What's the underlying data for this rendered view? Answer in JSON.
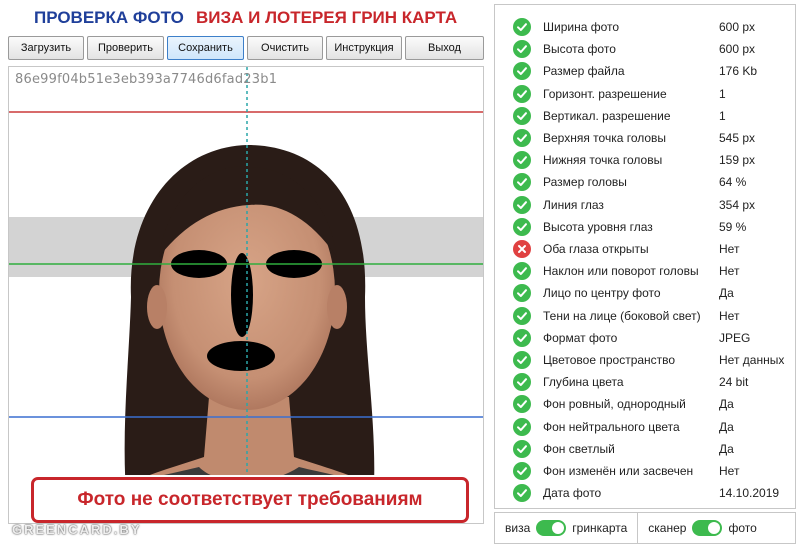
{
  "header": {
    "title_check": "ПРОВЕРКА ФОТО",
    "title_visa": "ВИЗА И ЛОТЕРЕЯ ГРИН КАРТА"
  },
  "toolbar": {
    "buttons": [
      {
        "label": "Загрузить"
      },
      {
        "label": "Проверить"
      },
      {
        "label": "Сохранить"
      },
      {
        "label": "Очистить"
      },
      {
        "label": "Инструкция"
      },
      {
        "label": "Выход"
      }
    ],
    "active": "Сохранить"
  },
  "photo": {
    "hash": "86e99f04b51e3eb393a7746d6fad23b1",
    "warning": "Фото не соответствует требованиям",
    "watermark": "GREENCARD.BY"
  },
  "checks": [
    {
      "label": "Ширина фото",
      "value": "600 px",
      "status": "ok"
    },
    {
      "label": "Высота фото",
      "value": "600 px",
      "status": "ok"
    },
    {
      "label": "Размер файла",
      "value": "176 Kb",
      "status": "ok"
    },
    {
      "label": "Горизонт. разрешение",
      "value": "1",
      "status": "ok"
    },
    {
      "label": "Вертикал. разрешение",
      "value": "1",
      "status": "ok"
    },
    {
      "label": "Верхняя точка головы",
      "value": "545 px",
      "status": "ok"
    },
    {
      "label": "Нижняя точка головы",
      "value": "159 px",
      "status": "ok"
    },
    {
      "label": "Размер головы",
      "value": "64 %",
      "status": "ok"
    },
    {
      "label": "Линия глаз",
      "value": "354 px",
      "status": "ok"
    },
    {
      "label": "Высота уровня глаз",
      "value": "59 %",
      "status": "ok"
    },
    {
      "label": "Оба глаза открыты",
      "value": "Нет",
      "status": "fail"
    },
    {
      "label": "Наклон или поворот головы",
      "value": "Нет",
      "status": "ok"
    },
    {
      "label": "Лицо по центру фото",
      "value": "Да",
      "status": "ok"
    },
    {
      "label": "Тени на лице (боковой свет)",
      "value": "Нет",
      "status": "ok"
    },
    {
      "label": "Формат фото",
      "value": "JPEG",
      "status": "ok"
    },
    {
      "label": "Цветовое пространство",
      "value": "Нет данных",
      "status": "ok"
    },
    {
      "label": "Глубина цвета",
      "value": "24 bit",
      "status": "ok"
    },
    {
      "label": "Фон ровный, однородный",
      "value": "Да",
      "status": "ok"
    },
    {
      "label": "Фон нейтрального цвета",
      "value": "Да",
      "status": "ok"
    },
    {
      "label": "Фон светлый",
      "value": "Да",
      "status": "ok"
    },
    {
      "label": "Фон изменён или засвечен",
      "value": "Нет",
      "status": "ok"
    },
    {
      "label": "Дата фото",
      "value": "14.10.2019",
      "status": "ok"
    }
  ],
  "toggles": {
    "left_off": "виза",
    "left_on": "гринкарта",
    "right_off": "сканер",
    "right_on": "фото"
  },
  "colors": {
    "ok": "#3dba4e",
    "fail": "#e04141",
    "accent_blue": "#1f3f9a",
    "accent_red": "#c8262b"
  }
}
